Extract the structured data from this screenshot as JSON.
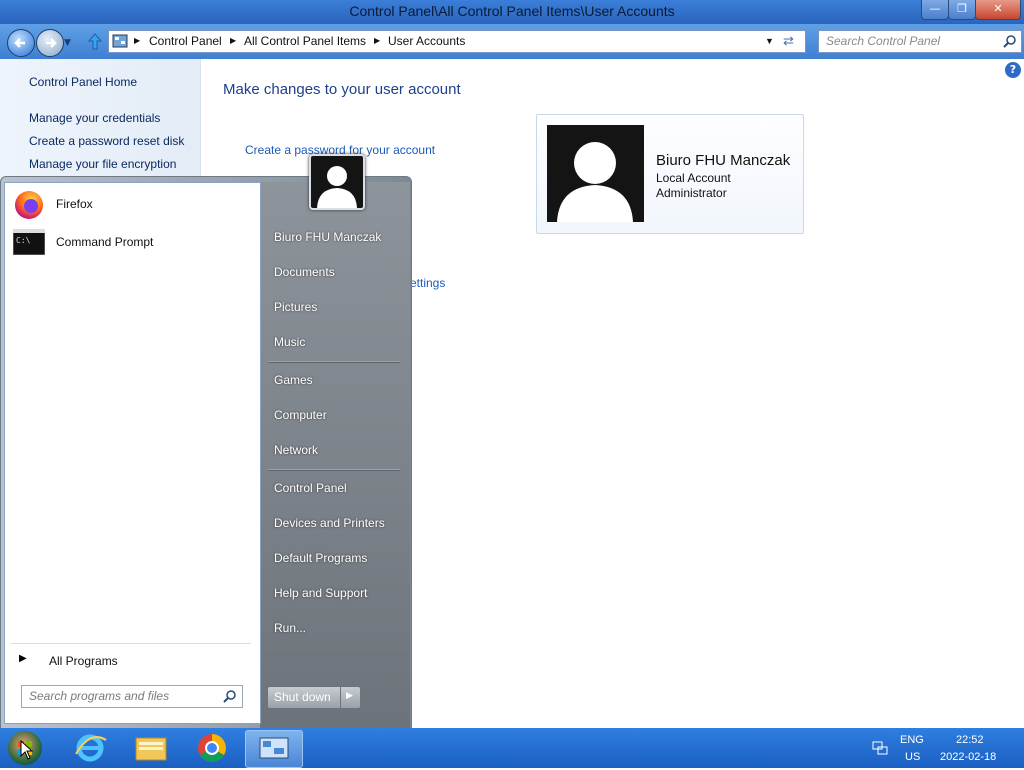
{
  "window": {
    "title": "Control Panel\\All Control Panel Items\\User Accounts"
  },
  "address": {
    "crumbs": [
      "Control Panel",
      "All Control Panel Items",
      "User Accounts"
    ],
    "search_placeholder": "Search Control Panel"
  },
  "sidebar": {
    "items": [
      "Control Panel Home",
      "Manage your credentials",
      "Create a password reset disk",
      "Manage your file encryption"
    ]
  },
  "content": {
    "title": "Make changes to your user account",
    "links": [
      "Create a password for your account",
      "ettings"
    ]
  },
  "account": {
    "name": "Biuro FHU Manczak",
    "type": "Local Account",
    "role": "Administrator"
  },
  "start_menu": {
    "pinned": [
      "Firefox",
      "Command Prompt"
    ],
    "all_programs": "All Programs",
    "search_placeholder": "Search programs and files",
    "right_items": [
      "Biuro FHU Manczak",
      "Documents",
      "Pictures",
      "Music",
      "Games",
      "Computer",
      "Network",
      "Control Panel",
      "Devices and Printers",
      "Default Programs",
      "Help and Support",
      "Run..."
    ],
    "shutdown": "Shut down"
  },
  "taskbar": {
    "lang1": "ENG",
    "lang2": "US",
    "time": "22:52",
    "date": "2022-02-18"
  },
  "colors": {
    "accent": "#1e3f8a",
    "link": "#1b5ab8",
    "taskbar": "#1b5fc2"
  }
}
